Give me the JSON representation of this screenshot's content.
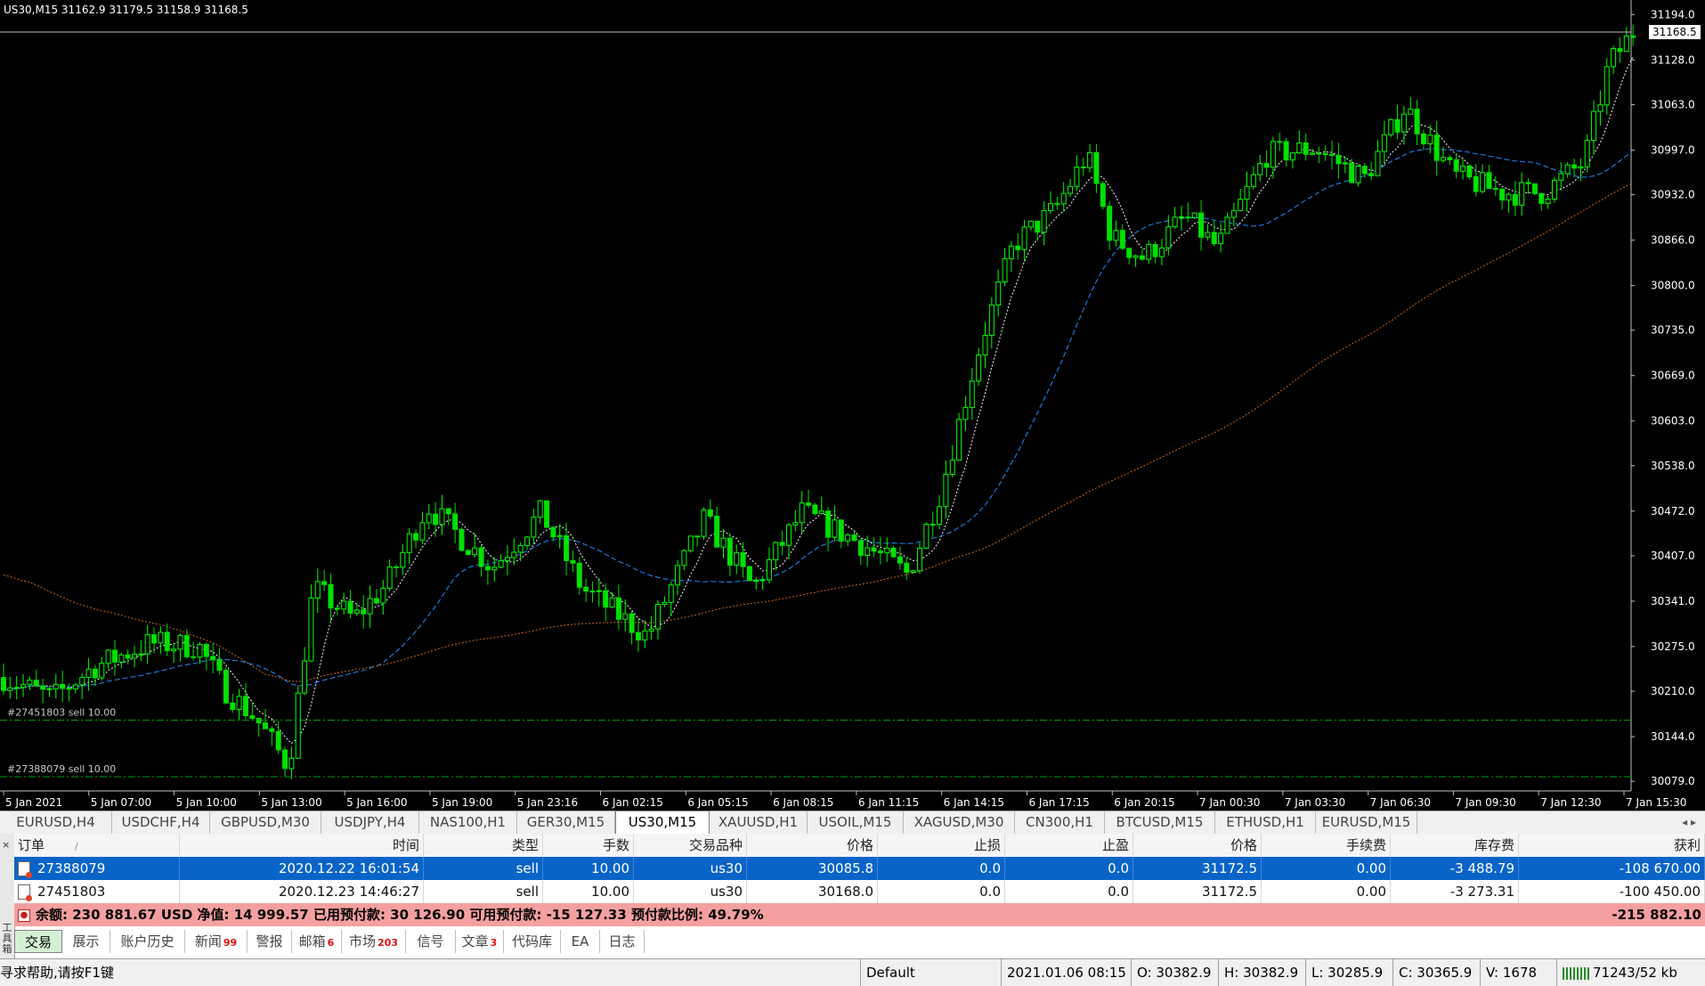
{
  "chart": {
    "header": "US30,M15  31162.9 31179.5 31158.9 31168.5",
    "current_price": 31168.5,
    "price_ticks": [
      31194.0,
      31128.0,
      31063.0,
      30997.0,
      30932.0,
      30866.0,
      30800.0,
      30735.0,
      30669.0,
      30603.0,
      30538.0,
      30472.0,
      30407.0,
      30341.0,
      30275.0,
      30210.0,
      30144.0,
      30079.0
    ],
    "time_ticks": [
      "5 Jan 2021",
      "5 Jan 07:00",
      "5 Jan 10:00",
      "5 Jan 13:00",
      "5 Jan 16:00",
      "5 Jan 19:00",
      "5 Jan 23:16",
      "6 Jan 02:15",
      "6 Jan 05:15",
      "6 Jan 08:15",
      "6 Jan 11:15",
      "6 Jan 14:15",
      "6 Jan 17:15",
      "6 Jan 20:15",
      "7 Jan 00:30",
      "7 Jan 03:30",
      "7 Jan 06:30",
      "7 Jan 09:30",
      "7 Jan 12:30",
      "7 Jan 15:30"
    ],
    "order_lines": [
      {
        "label": "#27451803 sell 10.00",
        "price": 30168.0
      },
      {
        "label": "#27388079 sell 10.00",
        "price": 30085.8
      }
    ],
    "colors": {
      "bull": "#00ff00",
      "bear": "#00e000",
      "ma_fast": "#ffffff",
      "ma_mid": "#1e90ff",
      "ma_slow": "#d2691e",
      "order_line": "#00a000"
    }
  },
  "symbol_tabs": [
    "EURUSD,H4",
    "USDCHF,H4",
    "GBPUSD,M30",
    "USDJPY,H4",
    "NAS100,H1",
    "GER30,M15",
    "US30,M15",
    "XAUUSD,H1",
    "USOIL,M15",
    "XAGUSD,M30",
    "CN300,H1",
    "BTCUSD,M15",
    "ETHUSD,H1",
    "EURUSD,M15"
  ],
  "active_symbol_tab": "US30,M15",
  "tab_arrows": "◂  ▸",
  "terminal": {
    "side_label": "工具箱",
    "close_glyph": "×",
    "columns": [
      "订单",
      "时间",
      "类型",
      "手数",
      "交易品种",
      "价格",
      "止损",
      "止盈",
      "价格",
      "手续费",
      "库存费",
      "获利"
    ],
    "sort_mark": "/",
    "orders": [
      {
        "order": "27388079",
        "time": "2020.12.22 16:01:54",
        "type": "sell",
        "lots": "10.00",
        "symbol": "us30",
        "open_price": "30085.8",
        "sl": "0.0",
        "tp": "0.0",
        "price": "31172.5",
        "commission": "0.00",
        "swap": "-3 488.79",
        "profit": "-108 670.00"
      },
      {
        "order": "27451803",
        "time": "2020.12.23 14:46:27",
        "type": "sell",
        "lots": "10.00",
        "symbol": "us30",
        "open_price": "30168.0",
        "sl": "0.0",
        "tp": "0.0",
        "price": "31172.5",
        "commission": "0.00",
        "swap": "-3 273.31",
        "profit": "-100 450.00"
      }
    ],
    "summary": {
      "text": "余额: 230 881.67 USD  净值: 14 999.57  已用预付款: 30 126.90  可用预付款: -15 127.33  预付款比例: 49.79%",
      "total_profit": "-215 882.10"
    }
  },
  "bottom_tabs": [
    {
      "label": "交易",
      "badge": ""
    },
    {
      "label": "展示",
      "badge": ""
    },
    {
      "label": "账户历史",
      "badge": ""
    },
    {
      "label": "新闻",
      "badge": "99"
    },
    {
      "label": "警报",
      "badge": ""
    },
    {
      "label": "邮箱",
      "badge": "6"
    },
    {
      "label": "市场",
      "badge": "203"
    },
    {
      "label": "信号",
      "badge": ""
    },
    {
      "label": "文章",
      "badge": "3"
    },
    {
      "label": "代码库",
      "badge": ""
    },
    {
      "label": "EA",
      "badge": ""
    },
    {
      "label": "日志",
      "badge": ""
    }
  ],
  "status_bar": {
    "help": "寻求帮助,请按F1键",
    "profile": "Default",
    "datetime": "2021.01.06 08:15",
    "open": "O: 30382.9",
    "high": "H: 30382.9",
    "low": "L: 30285.9",
    "close": "C: 30365.9",
    "volume": "V: 1678",
    "traffic": "71243/52 kb"
  }
}
